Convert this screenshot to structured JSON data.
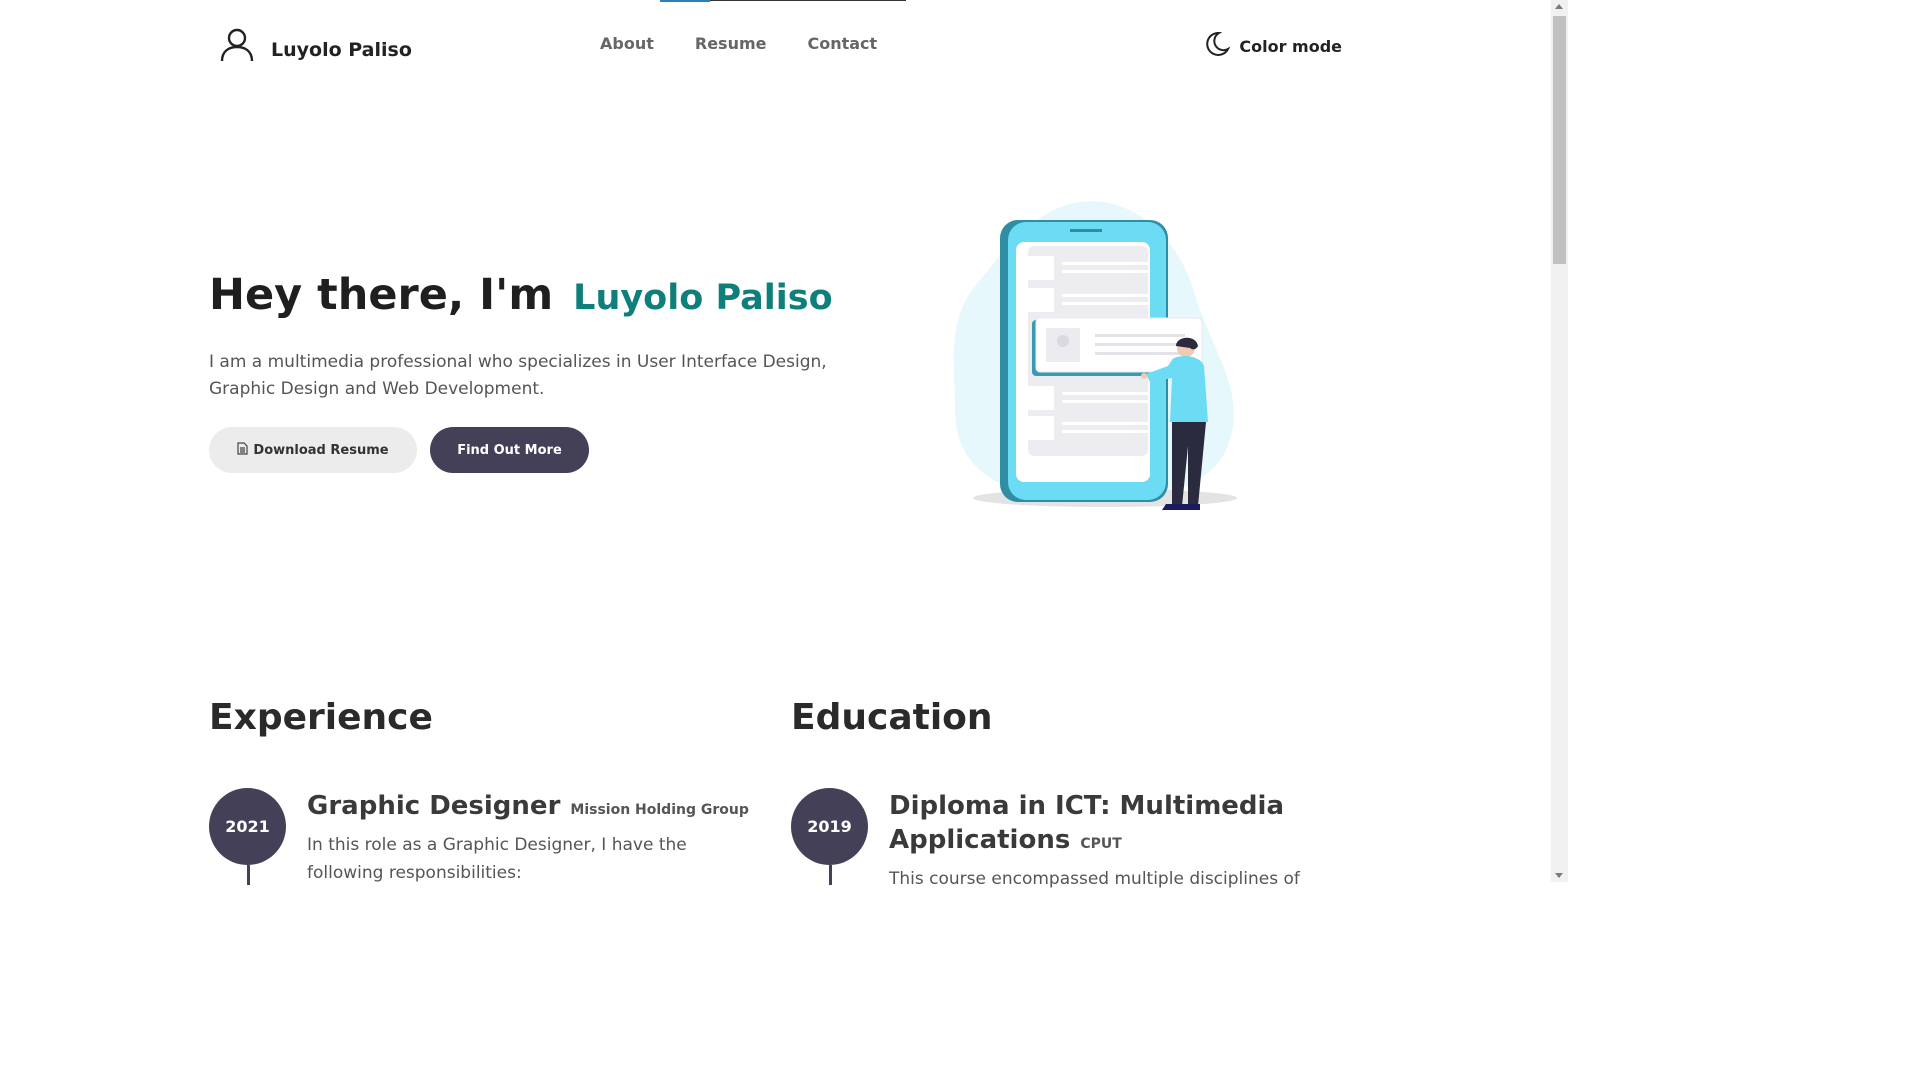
{
  "header": {
    "brand": "Luyolo Paliso",
    "nav": [
      "About",
      "Resume",
      "Contact"
    ],
    "color_mode_label": "Color mode"
  },
  "hero": {
    "greeting": "Hey there, I'm",
    "name": "Luyolo Paliso",
    "description": "I am a multimedia professional who specializes in User Interface Design, Graphic Design and Web Development.",
    "download_label": "Download Resume",
    "more_label": "Find Out More"
  },
  "experience": {
    "title": "Experience",
    "items": [
      {
        "year": "2021",
        "role": "Graphic Designer",
        "org": "Mission Holding Group",
        "text": "In this role as a Graphic Designer, I have the following responsibilities:"
      }
    ]
  },
  "education": {
    "title": "Education",
    "items": [
      {
        "year": "2019",
        "role_line1": "Diploma in ICT: Multimedia",
        "role_line2": "Applications",
        "org": "CPUT",
        "text": "This course encompassed multiple disciplines of"
      }
    ]
  },
  "colors": {
    "accent_teal": "#0f7f7b",
    "dark_button": "#434058",
    "light_button": "#ececec"
  }
}
